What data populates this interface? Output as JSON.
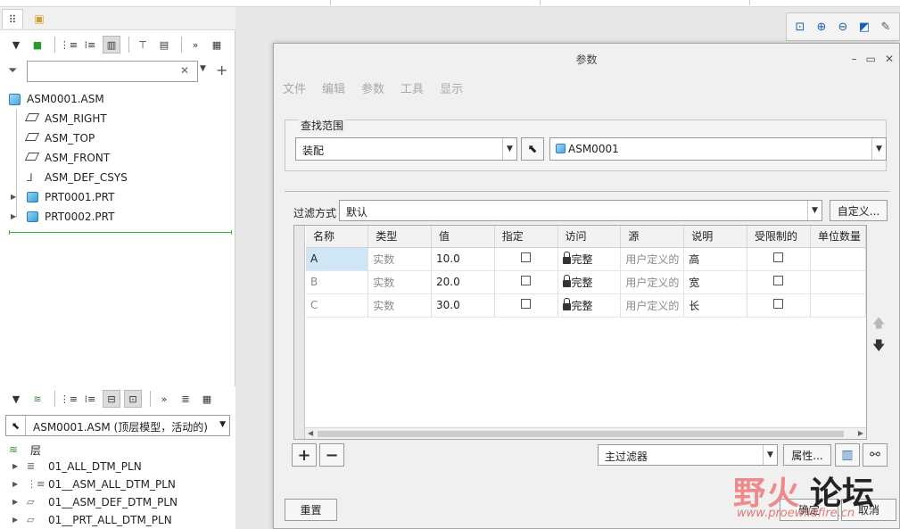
{
  "left_panel": {
    "tabs": [
      "model-tree-tab",
      "layers-tab"
    ],
    "filter_placeholder": "",
    "tree": [
      {
        "label": "ASM0001.ASM",
        "icon": "assembly-icon",
        "level": 0,
        "expander": false
      },
      {
        "label": "ASM_RIGHT",
        "icon": "datum-plane-icon",
        "level": 1,
        "expander": false
      },
      {
        "label": "ASM_TOP",
        "icon": "datum-plane-icon",
        "level": 1,
        "expander": false
      },
      {
        "label": "ASM_FRONT",
        "icon": "datum-plane-icon",
        "level": 1,
        "expander": false
      },
      {
        "label": "ASM_DEF_CSYS",
        "icon": "csys-icon",
        "level": 1,
        "expander": false
      },
      {
        "label": "PRT0001.PRT",
        "icon": "part-icon",
        "level": 1,
        "expander": true
      },
      {
        "label": "PRT0002.PRT",
        "icon": "part-icon",
        "level": 1,
        "expander": true
      }
    ],
    "layer_combo": "ASM0001.ASM (顶层模型，活动的)",
    "layer_root": "层",
    "layers": [
      "01_ALL_DTM_PLN",
      "01__ASM_ALL_DTM_PLN",
      "01__ASM_DEF_DTM_PLN",
      "01__PRT_ALL_DTM_PLN"
    ]
  },
  "dialog": {
    "title": "参数",
    "menu": [
      "文件",
      "编辑",
      "参数",
      "工具",
      "显示"
    ],
    "scope_label": "查找范围",
    "scope_type": "装配",
    "scope_model": "ASM0001",
    "filter_label": "过滤方式",
    "filter_value": "默认",
    "customize_button": "自定义...",
    "columns": [
      "名称",
      "类型",
      "值",
      "指定",
      "访问",
      "源",
      "说明",
      "受限制的",
      "单位数量"
    ],
    "rows": [
      {
        "name": "A",
        "type": "实数",
        "value": "10.0",
        "access": "完整",
        "source": "用户定义的",
        "description": "高"
      },
      {
        "name": "B",
        "type": "实数",
        "value": "20.0",
        "access": "完整",
        "source": "用户定义的",
        "description": "宽"
      },
      {
        "name": "C",
        "type": "实数",
        "value": "30.0",
        "access": "完整",
        "source": "用户定义的",
        "description": "长"
      }
    ],
    "add_button": "+",
    "remove_button": "−",
    "main_filter": "主过滤器",
    "properties_button": "属性...",
    "reset_button": "重置",
    "ok_button": "确定",
    "cancel_button": "取消"
  },
  "watermark": {
    "text_a": "野火",
    "text_b": "论坛",
    "url": "www.proewildfire.cn"
  }
}
